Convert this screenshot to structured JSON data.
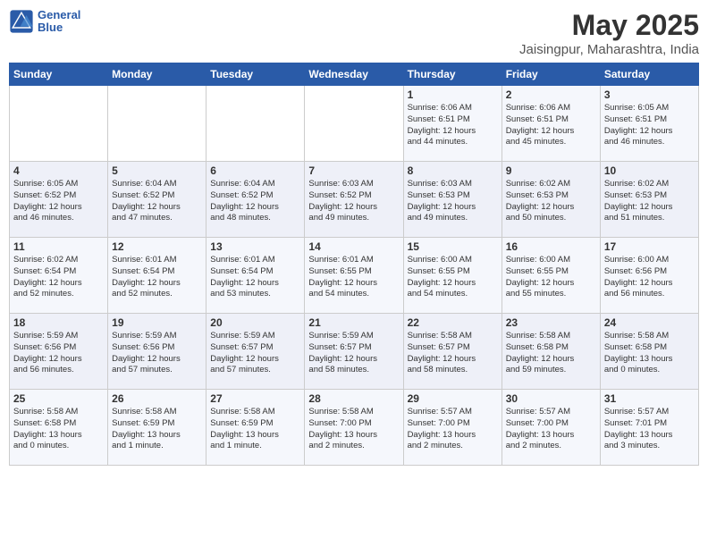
{
  "logo": {
    "line1": "General",
    "line2": "Blue"
  },
  "title": "May 2025",
  "subtitle": "Jaisingpur, Maharashtra, India",
  "days_of_week": [
    "Sunday",
    "Monday",
    "Tuesday",
    "Wednesday",
    "Thursday",
    "Friday",
    "Saturday"
  ],
  "weeks": [
    [
      {
        "day": "",
        "text": ""
      },
      {
        "day": "",
        "text": ""
      },
      {
        "day": "",
        "text": ""
      },
      {
        "day": "",
        "text": ""
      },
      {
        "day": "1",
        "text": "Sunrise: 6:06 AM\nSunset: 6:51 PM\nDaylight: 12 hours\nand 44 minutes."
      },
      {
        "day": "2",
        "text": "Sunrise: 6:06 AM\nSunset: 6:51 PM\nDaylight: 12 hours\nand 45 minutes."
      },
      {
        "day": "3",
        "text": "Sunrise: 6:05 AM\nSunset: 6:51 PM\nDaylight: 12 hours\nand 46 minutes."
      }
    ],
    [
      {
        "day": "4",
        "text": "Sunrise: 6:05 AM\nSunset: 6:52 PM\nDaylight: 12 hours\nand 46 minutes."
      },
      {
        "day": "5",
        "text": "Sunrise: 6:04 AM\nSunset: 6:52 PM\nDaylight: 12 hours\nand 47 minutes."
      },
      {
        "day": "6",
        "text": "Sunrise: 6:04 AM\nSunset: 6:52 PM\nDaylight: 12 hours\nand 48 minutes."
      },
      {
        "day": "7",
        "text": "Sunrise: 6:03 AM\nSunset: 6:52 PM\nDaylight: 12 hours\nand 49 minutes."
      },
      {
        "day": "8",
        "text": "Sunrise: 6:03 AM\nSunset: 6:53 PM\nDaylight: 12 hours\nand 49 minutes."
      },
      {
        "day": "9",
        "text": "Sunrise: 6:02 AM\nSunset: 6:53 PM\nDaylight: 12 hours\nand 50 minutes."
      },
      {
        "day": "10",
        "text": "Sunrise: 6:02 AM\nSunset: 6:53 PM\nDaylight: 12 hours\nand 51 minutes."
      }
    ],
    [
      {
        "day": "11",
        "text": "Sunrise: 6:02 AM\nSunset: 6:54 PM\nDaylight: 12 hours\nand 52 minutes."
      },
      {
        "day": "12",
        "text": "Sunrise: 6:01 AM\nSunset: 6:54 PM\nDaylight: 12 hours\nand 52 minutes."
      },
      {
        "day": "13",
        "text": "Sunrise: 6:01 AM\nSunset: 6:54 PM\nDaylight: 12 hours\nand 53 minutes."
      },
      {
        "day": "14",
        "text": "Sunrise: 6:01 AM\nSunset: 6:55 PM\nDaylight: 12 hours\nand 54 minutes."
      },
      {
        "day": "15",
        "text": "Sunrise: 6:00 AM\nSunset: 6:55 PM\nDaylight: 12 hours\nand 54 minutes."
      },
      {
        "day": "16",
        "text": "Sunrise: 6:00 AM\nSunset: 6:55 PM\nDaylight: 12 hours\nand 55 minutes."
      },
      {
        "day": "17",
        "text": "Sunrise: 6:00 AM\nSunset: 6:56 PM\nDaylight: 12 hours\nand 56 minutes."
      }
    ],
    [
      {
        "day": "18",
        "text": "Sunrise: 5:59 AM\nSunset: 6:56 PM\nDaylight: 12 hours\nand 56 minutes."
      },
      {
        "day": "19",
        "text": "Sunrise: 5:59 AM\nSunset: 6:56 PM\nDaylight: 12 hours\nand 57 minutes."
      },
      {
        "day": "20",
        "text": "Sunrise: 5:59 AM\nSunset: 6:57 PM\nDaylight: 12 hours\nand 57 minutes."
      },
      {
        "day": "21",
        "text": "Sunrise: 5:59 AM\nSunset: 6:57 PM\nDaylight: 12 hours\nand 58 minutes."
      },
      {
        "day": "22",
        "text": "Sunrise: 5:58 AM\nSunset: 6:57 PM\nDaylight: 12 hours\nand 58 minutes."
      },
      {
        "day": "23",
        "text": "Sunrise: 5:58 AM\nSunset: 6:58 PM\nDaylight: 12 hours\nand 59 minutes."
      },
      {
        "day": "24",
        "text": "Sunrise: 5:58 AM\nSunset: 6:58 PM\nDaylight: 13 hours\nand 0 minutes."
      }
    ],
    [
      {
        "day": "25",
        "text": "Sunrise: 5:58 AM\nSunset: 6:58 PM\nDaylight: 13 hours\nand 0 minutes."
      },
      {
        "day": "26",
        "text": "Sunrise: 5:58 AM\nSunset: 6:59 PM\nDaylight: 13 hours\nand 1 minute."
      },
      {
        "day": "27",
        "text": "Sunrise: 5:58 AM\nSunset: 6:59 PM\nDaylight: 13 hours\nand 1 minute."
      },
      {
        "day": "28",
        "text": "Sunrise: 5:58 AM\nSunset: 7:00 PM\nDaylight: 13 hours\nand 2 minutes."
      },
      {
        "day": "29",
        "text": "Sunrise: 5:57 AM\nSunset: 7:00 PM\nDaylight: 13 hours\nand 2 minutes."
      },
      {
        "day": "30",
        "text": "Sunrise: 5:57 AM\nSunset: 7:00 PM\nDaylight: 13 hours\nand 2 minutes."
      },
      {
        "day": "31",
        "text": "Sunrise: 5:57 AM\nSunset: 7:01 PM\nDaylight: 13 hours\nand 3 minutes."
      }
    ]
  ]
}
